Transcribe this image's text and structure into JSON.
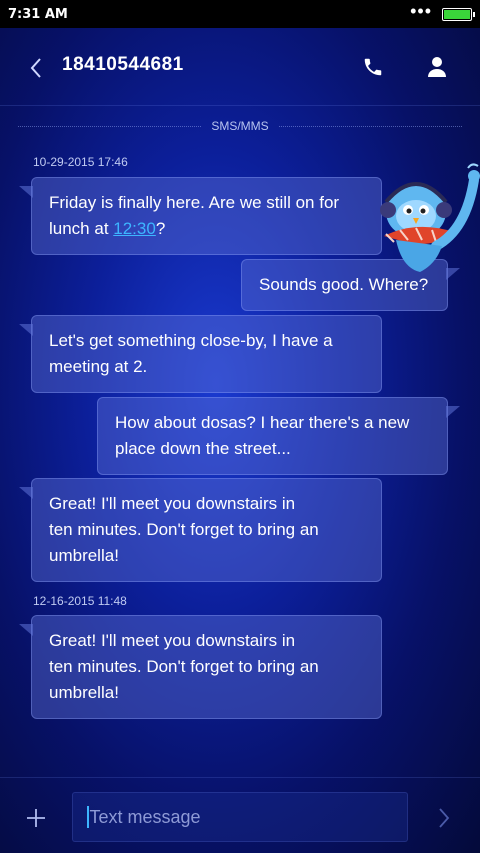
{
  "status": {
    "time": "7:31 AM",
    "battery_level": 1.0,
    "battery_color": "#3ad43a"
  },
  "header": {
    "contact": "18410544681",
    "icons": [
      "back-arrow-icon",
      "phone-icon",
      "person-icon"
    ]
  },
  "thread": {
    "channel_label": "SMS/MMS",
    "timestamps": [
      "10-29-2015 17:46",
      "12-16-2015 11:48"
    ],
    "messages": [
      {
        "direction": "in",
        "pre": "Friday is finally here. Are we still on for lunch at ",
        "link": "12:30",
        "post": "?"
      },
      {
        "direction": "out",
        "text": "Sounds good. Where?"
      },
      {
        "direction": "in",
        "text": "Let's get something close-by, I have a meeting at 2."
      },
      {
        "direction": "out",
        "text": "How about dosas? I hear there's a new place down the street..."
      },
      {
        "direction": "in",
        "line1": "Great! I'll meet you downstairs in",
        "line2": "ten minutes. Don't forget to bring an",
        "line3": "umbrella!"
      },
      {
        "direction": "in",
        "line1": "Great! I'll meet you downstairs in",
        "line2": "ten minutes. Don't forget to bring an",
        "line3": "umbrella!"
      }
    ]
  },
  "composer": {
    "placeholder": "Text message",
    "icons": [
      "plus-icon",
      "send-chevron-icon"
    ]
  },
  "colors": {
    "link": "#3db5ff",
    "accent_bg": "#0c1f9a"
  }
}
